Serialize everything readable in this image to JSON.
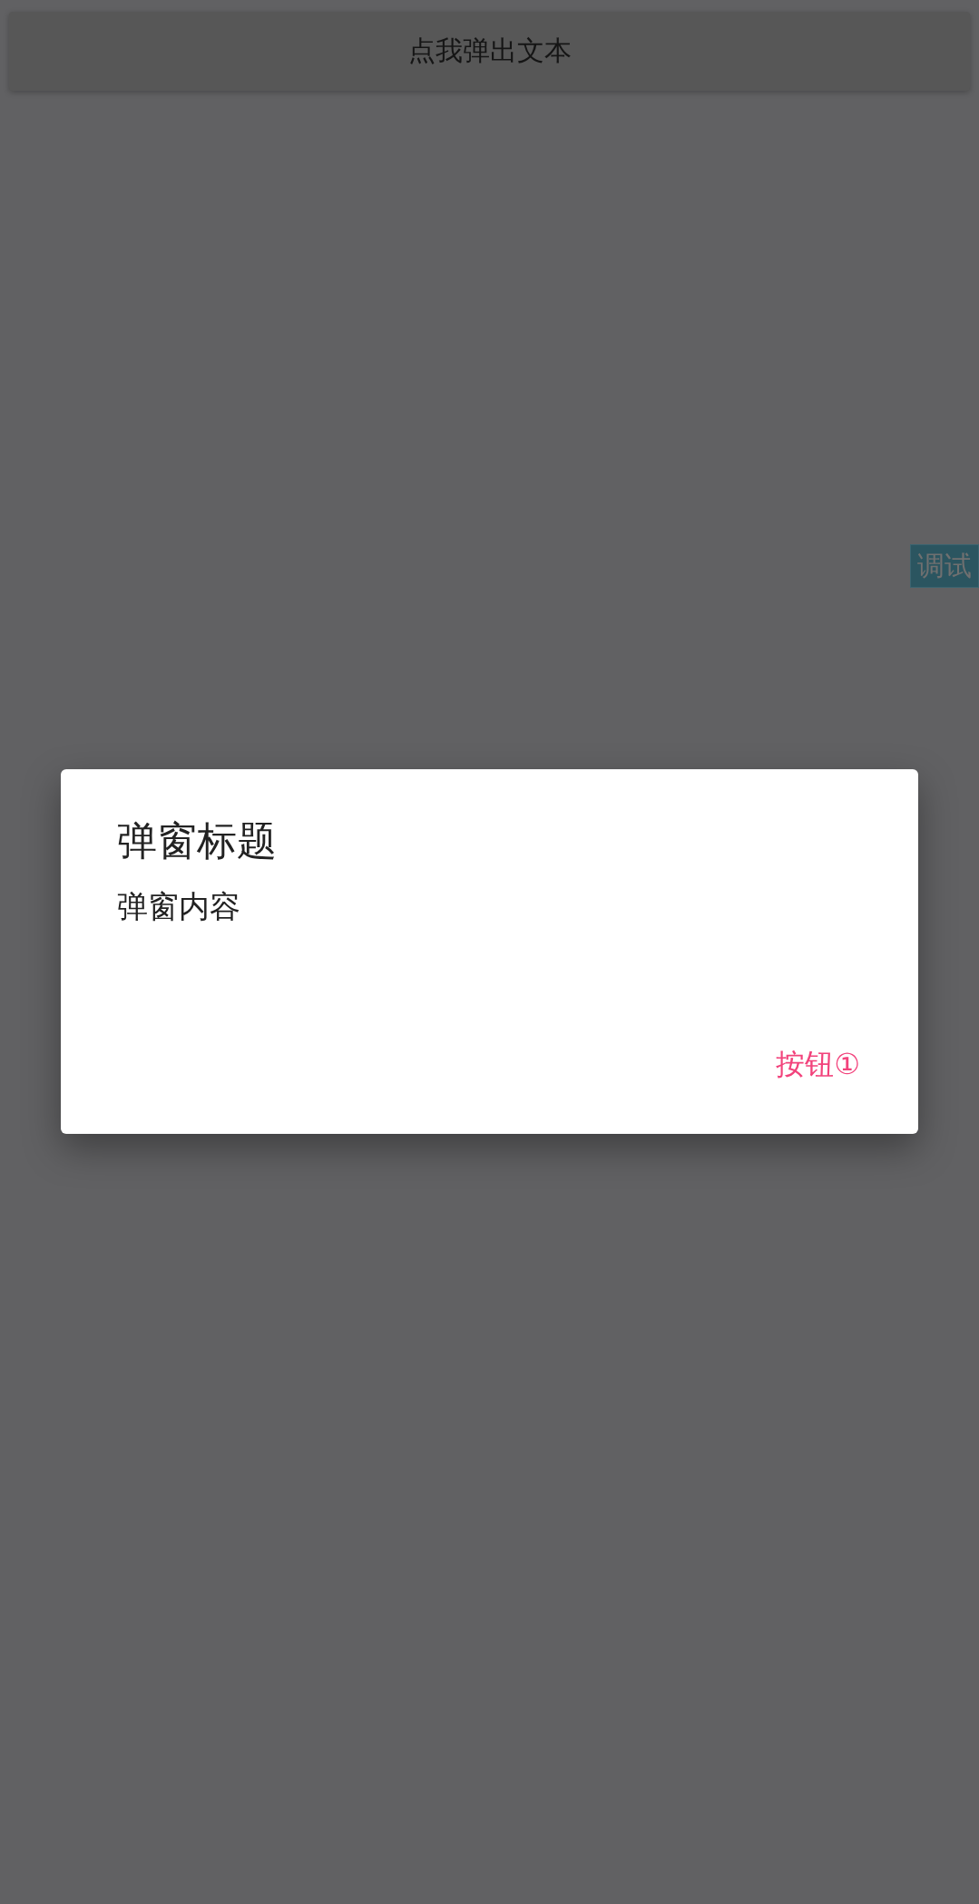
{
  "top_button": {
    "label": "点我弹出文本"
  },
  "debug_badge": {
    "label": "调试"
  },
  "dialog": {
    "title": "弹窗标题",
    "content": "弹窗内容",
    "buttons": [
      "按钮①"
    ]
  }
}
